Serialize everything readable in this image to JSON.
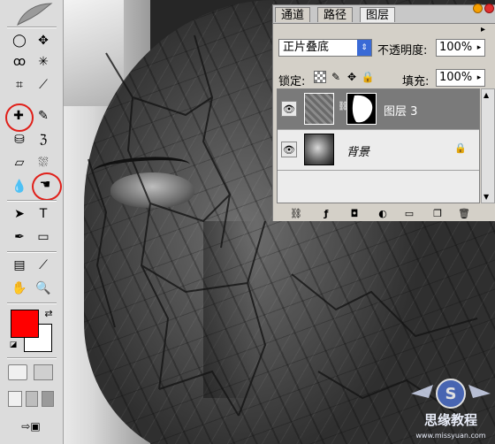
{
  "layers_panel": {
    "tabs": [
      "通道",
      "路径",
      "图层"
    ],
    "blend_mode": "正片叠底",
    "opacity_label": "不透明度:",
    "opacity_value": "100%",
    "lock_label": "锁定:",
    "fill_label": "填充:",
    "fill_value": "100%",
    "layers": [
      {
        "name": "图层 3",
        "selected": true
      },
      {
        "name": "背景",
        "selected": false
      }
    ]
  },
  "colors": {
    "foreground": "#ff0000",
    "background": "#ffffff",
    "highlight": "#e0201a"
  },
  "watermark": {
    "text": "思缘教程",
    "sub": "www.missyuan.com"
  }
}
